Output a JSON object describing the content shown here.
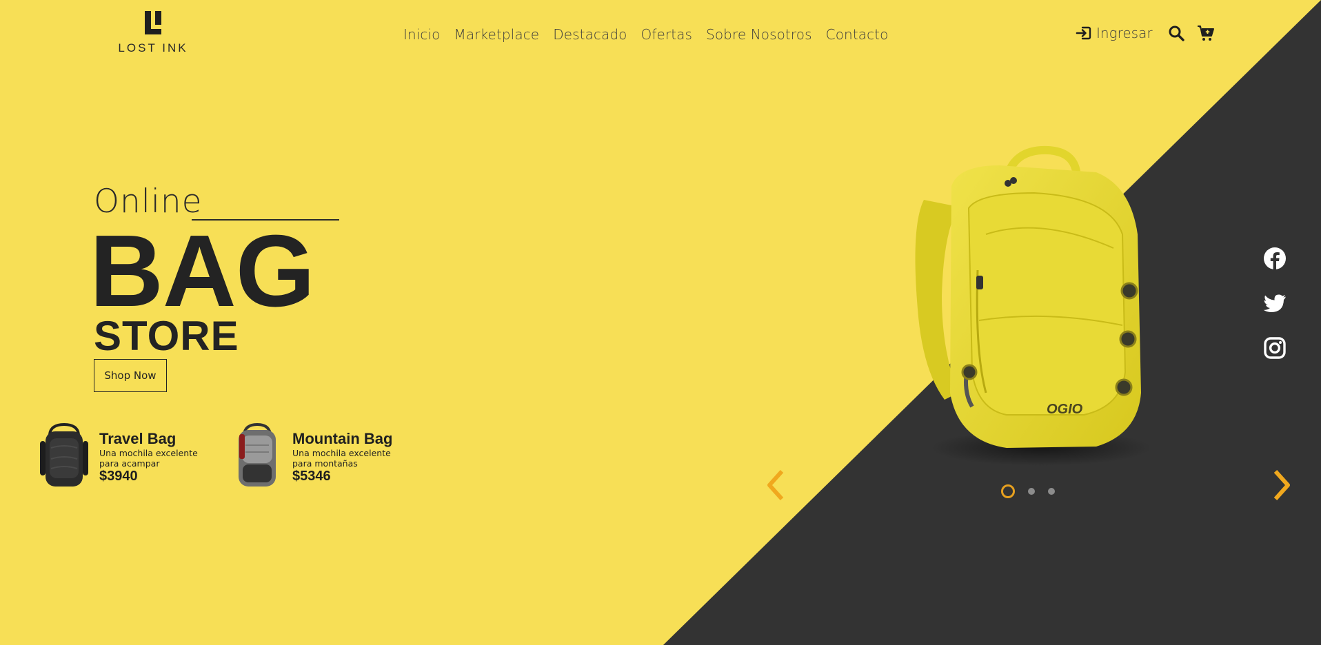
{
  "brand": {
    "name": "LOST INK"
  },
  "nav": {
    "items": [
      {
        "label": "Inicio"
      },
      {
        "label": "Marketplace"
      },
      {
        "label": "Destacado"
      },
      {
        "label": "Ofertas"
      },
      {
        "label": "Sobre Nosotros"
      },
      {
        "label": "Contacto"
      }
    ]
  },
  "header": {
    "login_label": "Ingresar",
    "icons": [
      "login-icon",
      "search-icon",
      "cart-icon"
    ]
  },
  "hero": {
    "kicker": "Online",
    "title": "BAG",
    "subtitle": "STORE",
    "cta_label": "Shop Now",
    "image_brand_mark": "OGIO"
  },
  "products": [
    {
      "name": "Travel Bag",
      "description": "Una mochila excelente para acampar",
      "price": "$3940"
    },
    {
      "name": "Mountain Bag",
      "description": "Una mochila excelente para montañas",
      "price": "$5346"
    }
  ],
  "carousel": {
    "slide_count": 3,
    "active_slide": 1,
    "icons": [
      "chevron-left-icon",
      "chevron-right-icon"
    ]
  },
  "social": {
    "icons": [
      "facebook-icon",
      "twitter-icon",
      "instagram-icon"
    ]
  },
  "colors": {
    "background": "#f7df56",
    "dark": "#333333",
    "accent": "#f0a81e",
    "text": "#232323",
    "social": "#ffffff"
  }
}
